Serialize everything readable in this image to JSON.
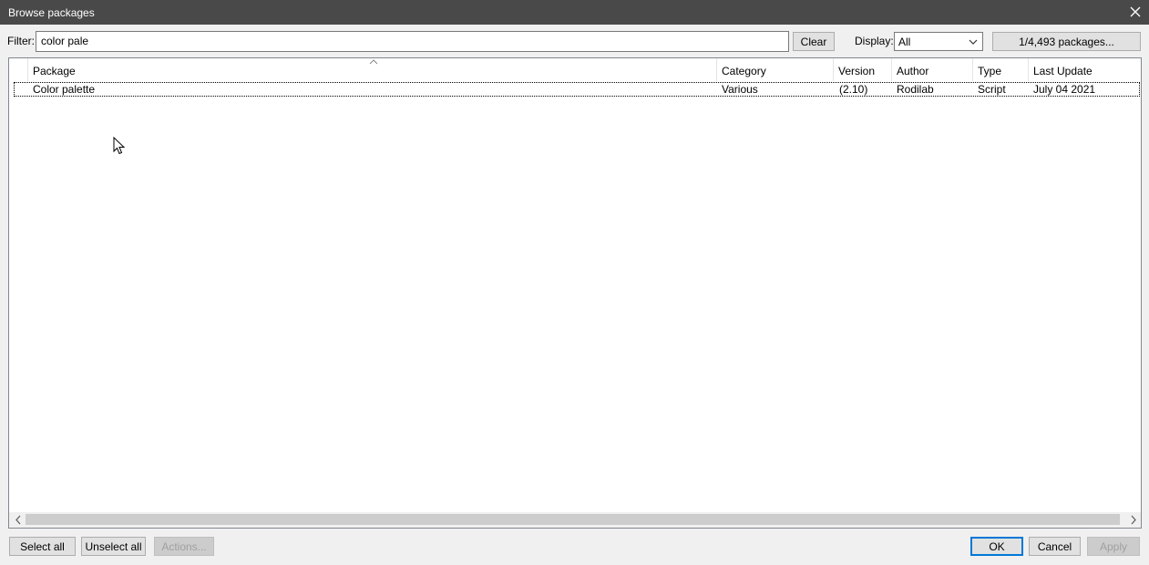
{
  "window": {
    "title": "Browse packages"
  },
  "filter": {
    "label": "Filter:",
    "value": "color pale"
  },
  "buttons": {
    "clear": "Clear",
    "packages_count": "1/4,493 packages...",
    "select_all": "Select all",
    "unselect_all": "Unselect all",
    "actions": "Actions...",
    "ok": "OK",
    "cancel": "Cancel",
    "apply": "Apply"
  },
  "display": {
    "label": "Display:",
    "selected": "All"
  },
  "table": {
    "columns": [
      "Package",
      "Category",
      "Version",
      "Author",
      "Type",
      "Last Update"
    ],
    "sort_column": "Package",
    "rows": [
      {
        "package": "Color palette",
        "category": "Various",
        "version": "(2.10)",
        "author": "Rodilab",
        "type": "Script",
        "last_update": "July 04 2021"
      }
    ]
  }
}
